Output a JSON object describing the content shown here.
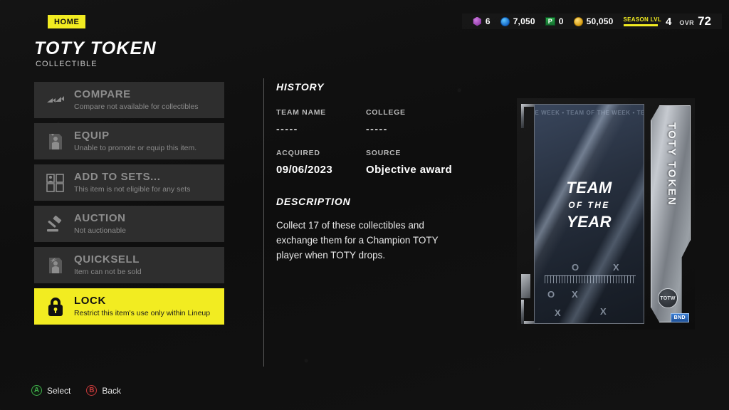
{
  "topbar": {
    "home_tab": "HOME",
    "currencies": [
      {
        "icon": "purple-gem-icon",
        "value": "6"
      },
      {
        "icon": "blue-coin-icon",
        "value": "7,050"
      },
      {
        "icon": "green-points-icon",
        "value": "0",
        "glyph": "P"
      },
      {
        "icon": "gold-coin-icon",
        "value": "50,050"
      }
    ],
    "season": {
      "label": "SEASON LVL",
      "value": "4"
    },
    "ovr": {
      "label": "OVR",
      "value": "72"
    }
  },
  "header": {
    "title": "TOTY TOKEN",
    "subtitle": "COLLECTIBLE"
  },
  "actions": [
    {
      "icon": "compare-arrows-icon",
      "title": "COMPARE",
      "desc": "Compare not available for collectibles",
      "state": "disabled"
    },
    {
      "icon": "equip-player-icon",
      "title": "EQUIP",
      "desc": "Unable to promote or equip this item.",
      "state": "disabled"
    },
    {
      "icon": "sets-grid-icon",
      "title": "ADD TO SETS...",
      "desc": "This item is not eligible for any sets",
      "state": "disabled"
    },
    {
      "icon": "gavel-icon",
      "title": "AUCTION",
      "desc": "Not auctionable",
      "state": "disabled"
    },
    {
      "icon": "quicksell-icon",
      "title": "QUICKSELL",
      "desc": "Item can not be sold",
      "state": "disabled"
    },
    {
      "icon": "lock-icon",
      "title": "LOCK",
      "desc": "Restrict this item's use only within Lineup",
      "state": "active"
    }
  ],
  "details": {
    "history_heading": "HISTORY",
    "fields": [
      {
        "label": "TEAM NAME",
        "value": "-----"
      },
      {
        "label": "COLLEGE",
        "value": "-----"
      },
      {
        "label": "ACQUIRED",
        "value": "09/06/2023"
      },
      {
        "label": "SOURCE",
        "value": "Objective award"
      }
    ],
    "description_heading": "DESCRIPTION",
    "description": "Collect 17 of these collectibles and exchange them for a Champion TOTY player when TOTY drops."
  },
  "card": {
    "ticker": "HE WEEK • TEAM OF THE WEEK • TEAM O",
    "title_line1": "TEAM",
    "title_line2": "OF THE",
    "title_line3": "YEAR",
    "side_label": "TOTY TOKEN",
    "badge": "TOTW",
    "tag": "BND"
  },
  "footer": {
    "prompts": [
      {
        "button": "A",
        "label": "Select"
      },
      {
        "button": "B",
        "label": "Back"
      }
    ]
  },
  "colors": {
    "accent_yellow": "#f2ec21",
    "background": "#111111",
    "row": "#2e2e2e"
  }
}
